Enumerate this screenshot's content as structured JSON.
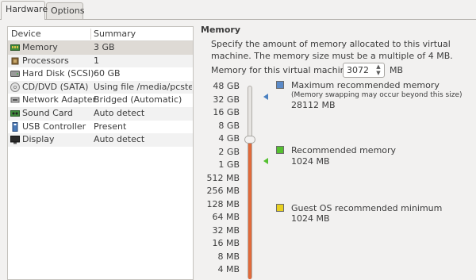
{
  "tabs": [
    {
      "label": "Hardware",
      "active": true
    },
    {
      "label": "Options",
      "active": false
    }
  ],
  "devices": {
    "header": {
      "device": "Device",
      "summary": "Summary"
    },
    "rows": [
      {
        "icon": "memory-icon",
        "device": "Memory",
        "summary": "3 GB",
        "selected": true
      },
      {
        "icon": "processor-icon",
        "device": "Processors",
        "summary": "1"
      },
      {
        "icon": "hard-disk-icon",
        "device": "Hard Disk (SCSI)",
        "summary": "60 GB"
      },
      {
        "icon": "cd-dvd-icon",
        "device": "CD/DVD (SATA)",
        "summary": "Using file /media/pcsteps"
      },
      {
        "icon": "network-adapter-icon",
        "device": "Network Adapter",
        "summary": "Bridged (Automatic)"
      },
      {
        "icon": "sound-card-icon",
        "device": "Sound Card",
        "summary": "Auto detect"
      },
      {
        "icon": "usb-controller-icon",
        "device": "USB Controller",
        "summary": "Present"
      },
      {
        "icon": "display-icon",
        "device": "Display",
        "summary": "Auto detect"
      }
    ]
  },
  "memory": {
    "title": "Memory",
    "description": "Specify the amount of memory allocated to this virtual machine. The memory size must be a multiple of 4 MB.",
    "field_label": "Memory for this virtual machine:",
    "value": "3072",
    "unit": "MB",
    "scale": [
      "48 GB",
      "32 GB",
      "16 GB",
      "8 GB",
      "4 GB",
      "2 GB",
      "1 GB",
      "512 MB",
      "256 MB",
      "128 MB",
      "64 MB",
      "32 MB",
      "16 MB",
      "8 MB",
      "4 MB"
    ],
    "legend": {
      "max": {
        "title": "Maximum recommended memory",
        "note": "(Memory swapping may occur beyond this size)",
        "value": "28112 MB",
        "color": "#4a80c0"
      },
      "recommended": {
        "title": "Recommended memory",
        "value": "1024 MB",
        "color": "#55c030"
      },
      "guest_min": {
        "title": "Guest OS recommended minimum",
        "value": "1024 MB",
        "color": "#e8d020"
      }
    },
    "fill_color": "#e06a3b"
  }
}
